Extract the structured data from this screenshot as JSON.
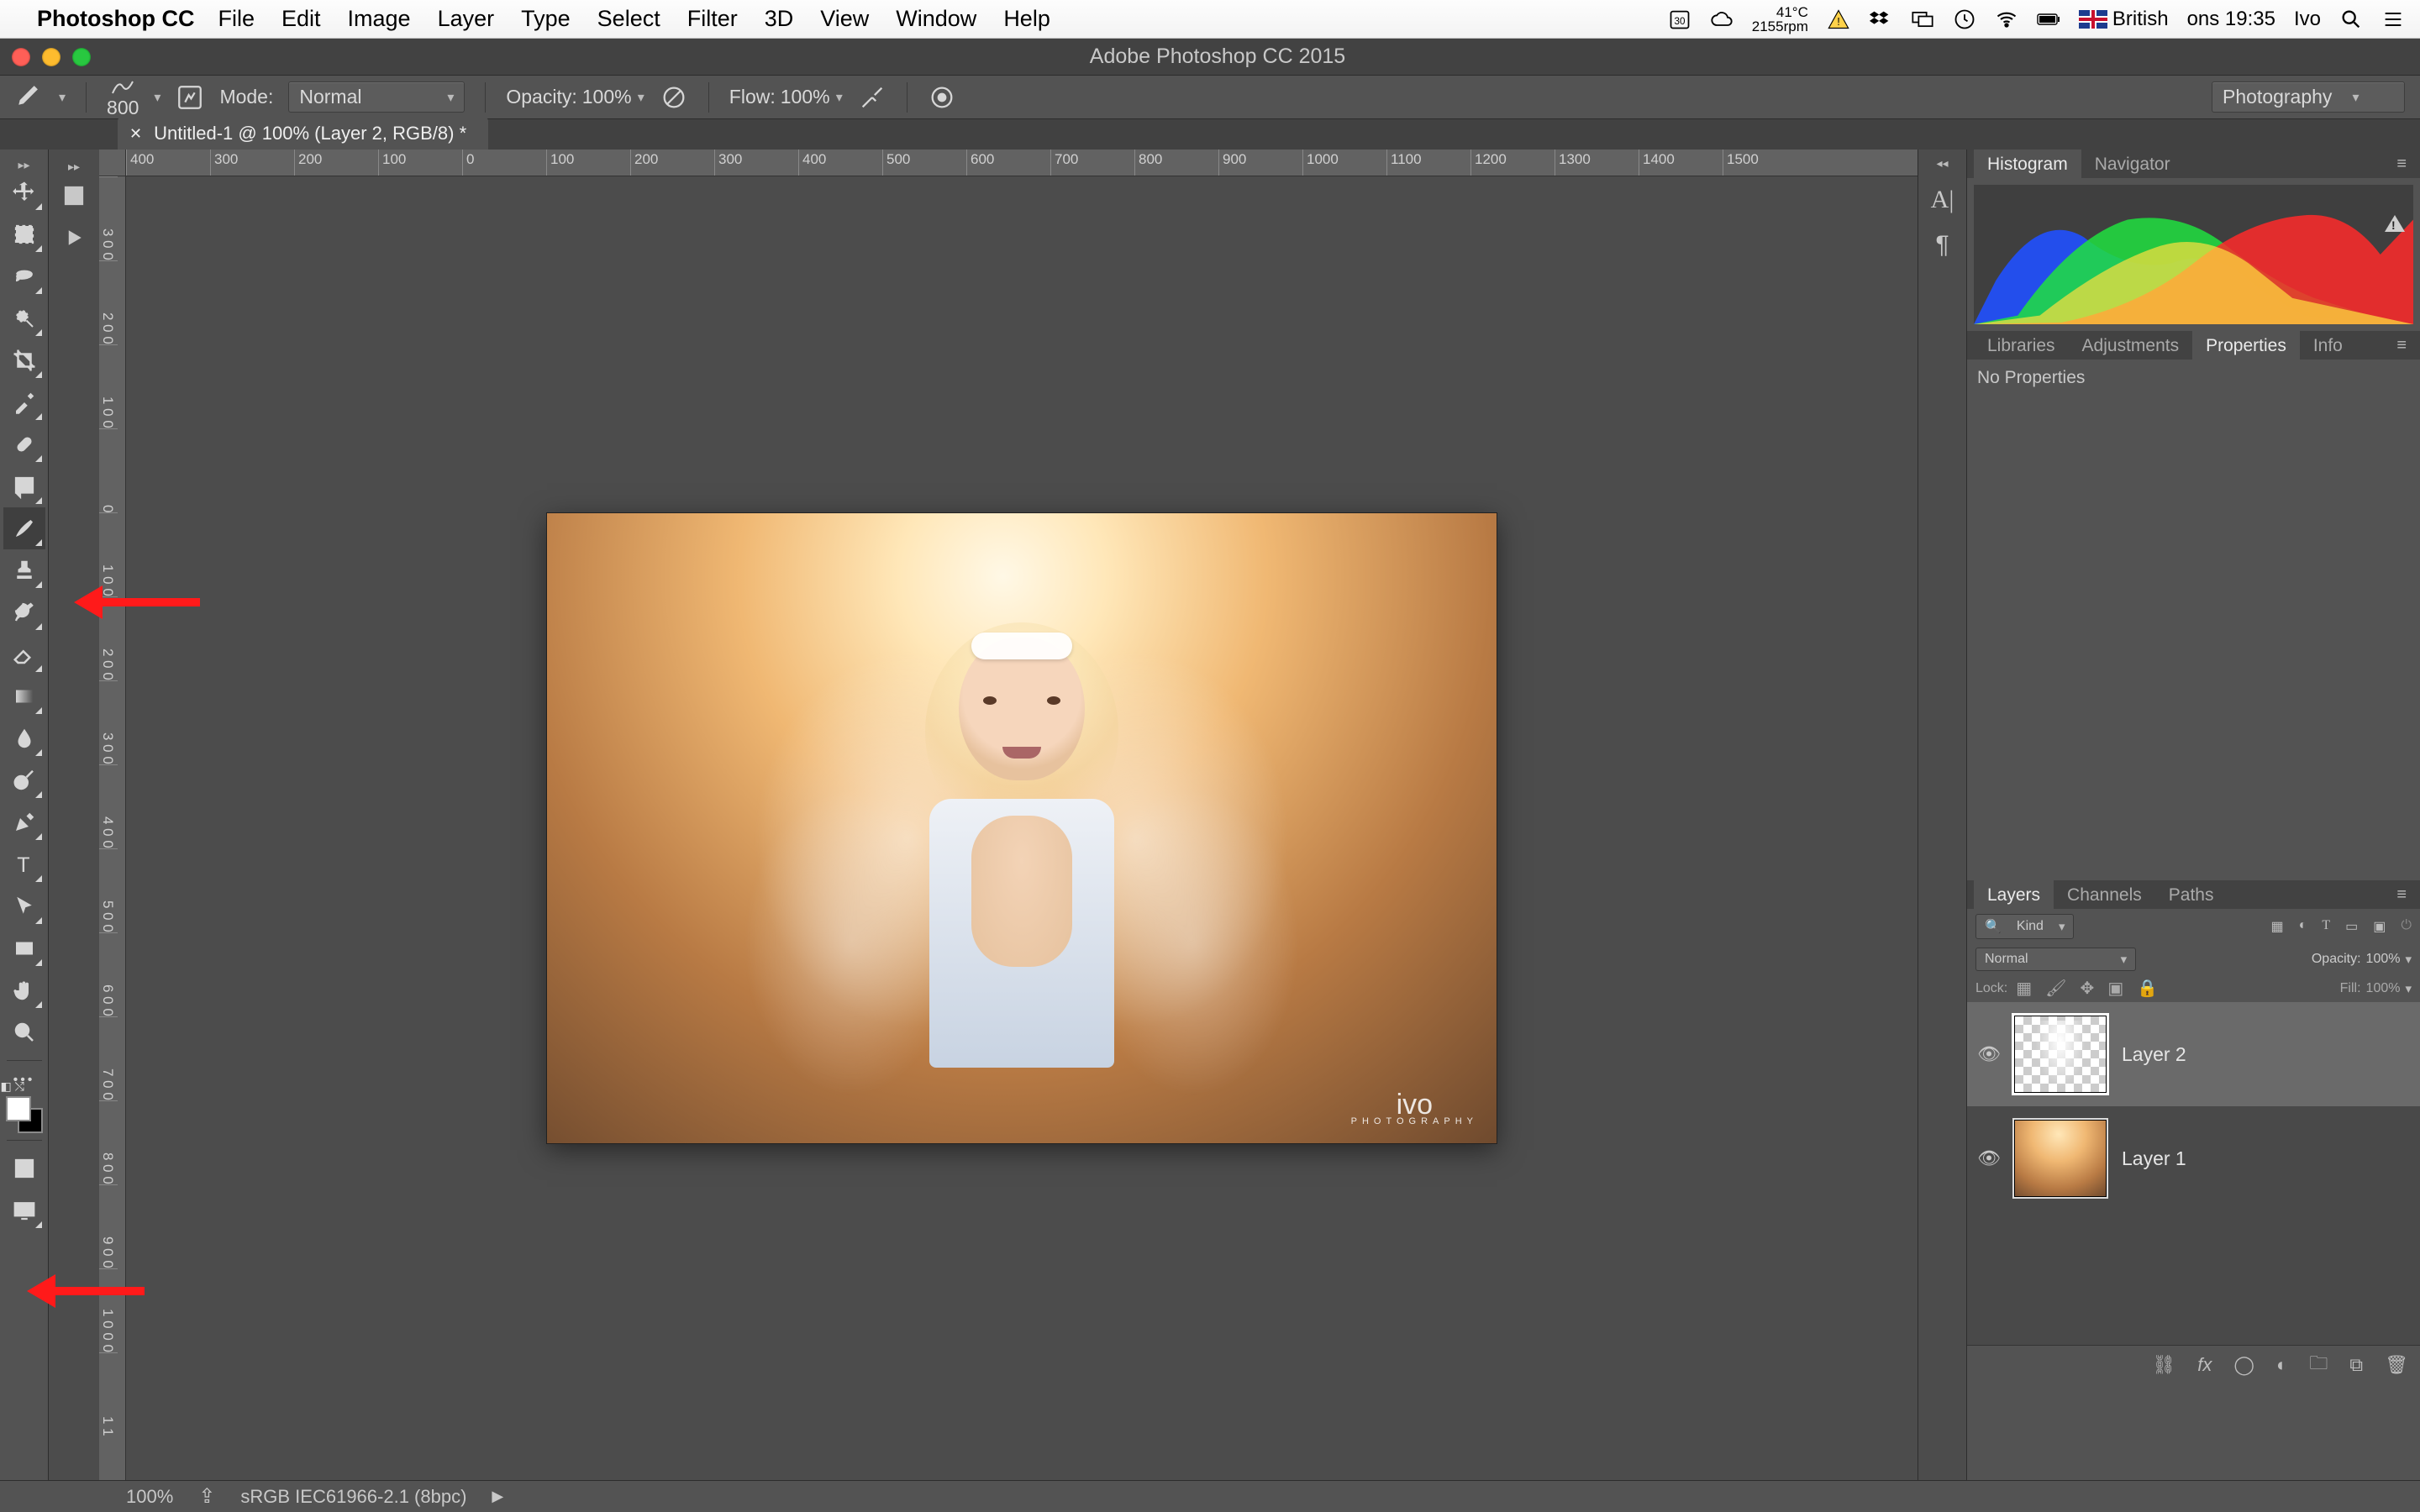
{
  "macmenu": {
    "app": "Photoshop CC",
    "items": [
      "File",
      "Edit",
      "Image",
      "Layer",
      "Type",
      "Select",
      "Filter",
      "3D",
      "View",
      "Window",
      "Help"
    ],
    "status": {
      "cal_day": "30",
      "temp": "41°C",
      "rpm": "2155rpm",
      "keyboard": "British",
      "day_time": "ons 19:35",
      "user": "Ivo"
    }
  },
  "titlebar": "Adobe Photoshop CC 2015",
  "options": {
    "brush_size": "800",
    "mode_label": "Mode:",
    "mode_value": "Normal",
    "opacity_label": "Opacity:",
    "opacity_value": "100%",
    "flow_label": "Flow:",
    "flow_value": "100%",
    "workspace": "Photography"
  },
  "doc_tab": {
    "title": "Untitled-1 @ 100% (Layer 2, RGB/8) *"
  },
  "rulers": {
    "h": [
      "400",
      "300",
      "200",
      "100",
      "0",
      "100",
      "200",
      "300",
      "400",
      "500",
      "600",
      "700",
      "800",
      "900",
      "1000",
      "1100",
      "1200",
      "1300",
      "1400",
      "1500"
    ],
    "v": [
      "3 0 0",
      "2 0 0",
      "1 0 0",
      "0",
      "1 0 0",
      "2 0 0",
      "3 0 0",
      "4 0 0",
      "5 0 0",
      "6 0 0",
      "7 0 0",
      "8 0 0",
      "9 0 0",
      "1 0 0 0",
      "1 1"
    ]
  },
  "watermark": {
    "script": "ivo",
    "sub": "PHOTOGRAPHY"
  },
  "panels": {
    "hist_tabs": [
      "Histogram",
      "Navigator"
    ],
    "hist_active": 0,
    "libs_tabs": [
      "Libraries",
      "Adjustments",
      "Properties",
      "Info"
    ],
    "libs_active": 2,
    "properties_empty": "No Properties",
    "layers_tabs": [
      "Layers",
      "Channels",
      "Paths"
    ],
    "layers_active": 0,
    "filter_kind": "Kind",
    "blend_mode": "Normal",
    "opacity_label": "Opacity:",
    "opacity_value": "100%",
    "lock_label": "Lock:",
    "fill_label": "Fill:",
    "fill_value": "100%",
    "layers": [
      {
        "name": "Layer 2",
        "selected": true,
        "thumb": "checker"
      },
      {
        "name": "Layer 1",
        "selected": false,
        "thumb": "photo"
      }
    ]
  },
  "statusbar": {
    "zoom": "100%",
    "profile": "sRGB IEC61966-2.1 (8bpc)"
  },
  "icons": {
    "move": "move-tool",
    "marquee": "marquee-tool",
    "lasso": "lasso-tool",
    "quick": "quick-select-tool",
    "crop": "crop-tool",
    "eyedrop": "eyedropper-tool",
    "patch": "patch-tool",
    "brush": "brush-tool",
    "stamp": "stamp-tool",
    "history": "history-brush-tool",
    "eraser": "eraser-tool",
    "gradient": "gradient-tool",
    "blur": "blur-tool",
    "dodge": "dodge-tool",
    "pen": "pen-tool",
    "type": "type-tool",
    "path": "path-select-tool",
    "shape": "rectangle-tool",
    "hand": "hand-tool",
    "zoom": "zoom-tool",
    "more": "more-tools",
    "ruler": "ruler-tool",
    "note": "note-tool"
  }
}
